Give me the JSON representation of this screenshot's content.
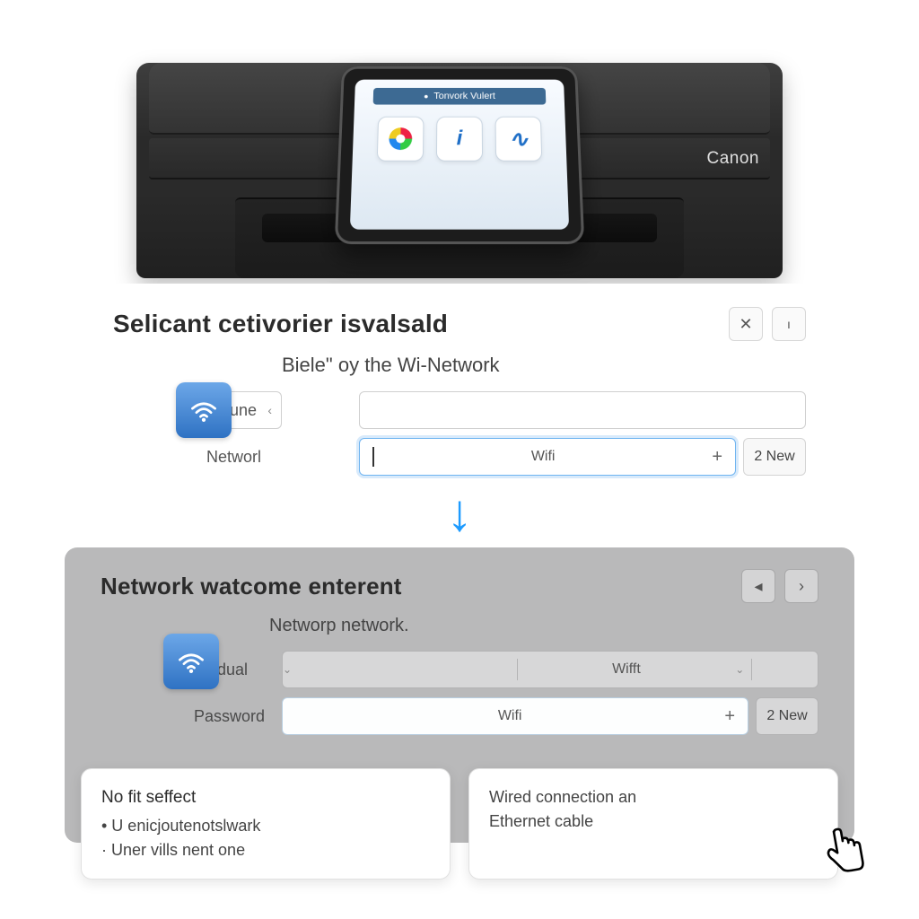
{
  "printer": {
    "brand": "Canon",
    "lcd_title": "Tonvork Vulert",
    "icon_wifi": "i",
    "icon_wave": "∿"
  },
  "panel1": {
    "title": "Selicant cetivorier isvalsald",
    "close": "✕",
    "help": "ı",
    "subtitle": "Biele\" oy the Wi-Network",
    "row1_label": "Flune",
    "row1_arrow": "‹",
    "row1_value": "",
    "row2_label": "Networl",
    "row2_value": "Wifi",
    "row2_plus": "+",
    "new_btn": "2 New"
  },
  "arrow_glyph": "↓",
  "panel2": {
    "title": "Network watcome enterent",
    "nav_prev": "◂",
    "nav_next": "›",
    "subtitle": "Networp network.",
    "row1_label": "Aladual",
    "row1_mid": "Wifft",
    "row2_label": "Password",
    "row2_value": "Wifi",
    "row2_plus": "+",
    "new_btn": "2 New"
  },
  "cards": {
    "left_title": "No fit seffect",
    "left_line1": "• U enicjoutenotslwark",
    "left_line2": "· Uner vills nent one",
    "right_line1": "Wired connection an",
    "right_line2": "Ethernet cable"
  },
  "cursor_glyph": "☞"
}
